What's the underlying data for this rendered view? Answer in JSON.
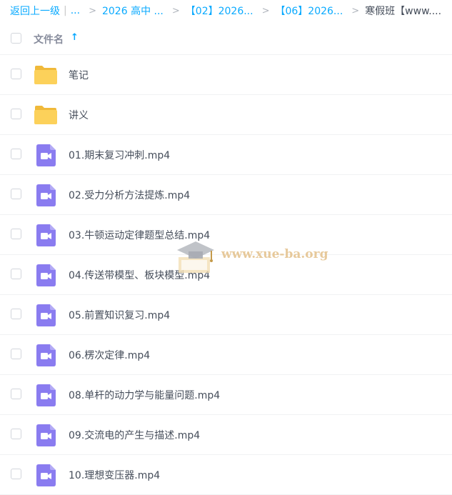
{
  "breadcrumb": {
    "back_label": "返回上一级",
    "separator": "|",
    "ellipsis": "...",
    "arrow": ">",
    "items": [
      "2026 高中 ...",
      "【02】2026...",
      "【06】2026..."
    ],
    "current": "寒假班【www...."
  },
  "header": {
    "column_label": "文件名",
    "sort_arrow": "↑"
  },
  "files": [
    {
      "name": "笔记",
      "type": "folder"
    },
    {
      "name": "讲义",
      "type": "folder"
    },
    {
      "name": "01.期末复习冲刺.mp4",
      "type": "video"
    },
    {
      "name": "02.受力分析方法提炼.mp4",
      "type": "video"
    },
    {
      "name": "03.牛顿运动定律题型总结.mp4",
      "type": "video"
    },
    {
      "name": "04.传送带模型、板块模型.mp4",
      "type": "video"
    },
    {
      "name": "05.前置知识复习.mp4",
      "type": "video"
    },
    {
      "name": "06.楞次定律.mp4",
      "type": "video"
    },
    {
      "name": "08.单杆的动力学与能量问题.mp4",
      "type": "video"
    },
    {
      "name": "09.交流电的产生与描述.mp4",
      "type": "video"
    },
    {
      "name": "10.理想变压器.mp4",
      "type": "video"
    }
  ],
  "watermark": {
    "text": "www.xue-ba.org"
  },
  "colors": {
    "link": "#09aaff",
    "folder": "#fcd15a",
    "video": "#8a7cf0",
    "text": "#454d5a"
  }
}
